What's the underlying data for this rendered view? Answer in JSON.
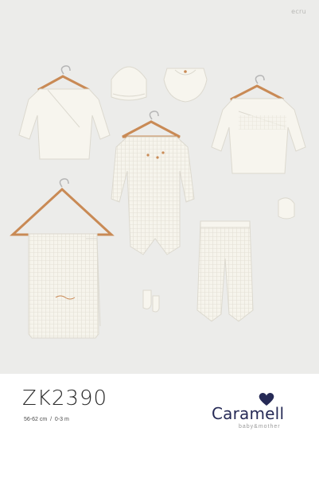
{
  "photo": {
    "color_tag": "ecru",
    "background": "#ececea",
    "garment_color": "#f7f5ee",
    "hanger_color": "#c98a55"
  },
  "product": {
    "code": "ZK2390",
    "size": "56-62 cm",
    "separator": "/",
    "age": "0-3 m"
  },
  "brand": {
    "name": "Caramell",
    "tagline": "baby&mother",
    "color": "#262a56",
    "logo_icon": "heart-icon"
  }
}
